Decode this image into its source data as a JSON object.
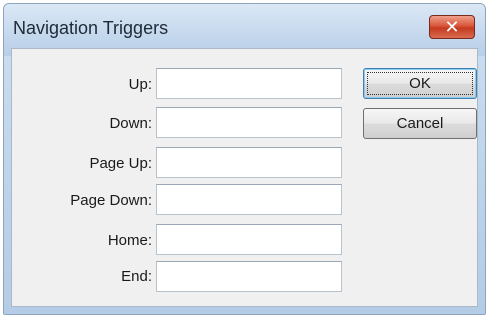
{
  "window": {
    "title": "Navigation Triggers",
    "close_icon": "close-icon"
  },
  "fields": [
    {
      "label": "Up:",
      "value": ""
    },
    {
      "label": "Down:",
      "value": ""
    },
    {
      "label": "Page Up:",
      "value": ""
    },
    {
      "label": "Page Down:",
      "value": ""
    },
    {
      "label": "Home:",
      "value": ""
    },
    {
      "label": "End:",
      "value": ""
    }
  ],
  "buttons": {
    "ok": "OK",
    "cancel": "Cancel"
  },
  "colors": {
    "close_button": "#c43a1f",
    "default_button_border": "#3c7fb1"
  }
}
